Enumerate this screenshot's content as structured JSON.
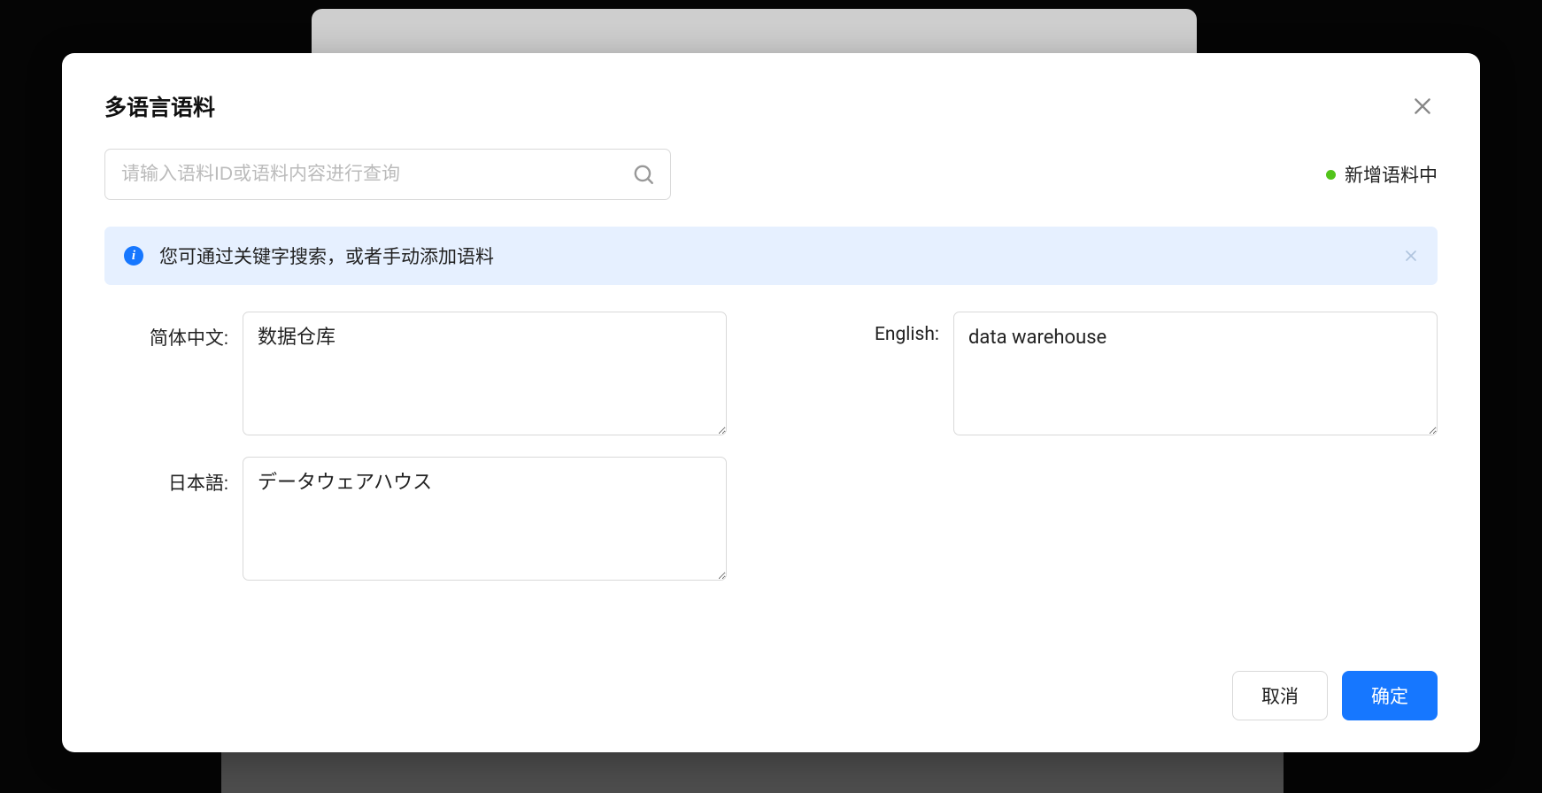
{
  "modal": {
    "title": "多语言语料",
    "search": {
      "placeholder": "请输入语料ID或语料内容进行查询"
    },
    "status": {
      "text": "新增语料中"
    },
    "alert": {
      "text": "您可通过关键字搜索，或者手动添加语料"
    },
    "fields": {
      "zh_cn": {
        "label": "简体中文:",
        "value": "数据仓库"
      },
      "en": {
        "label": "English:",
        "value": "data warehouse"
      },
      "ja": {
        "label": "日本語:",
        "value": "データウェアハウス"
      }
    },
    "footer": {
      "cancel": "取消",
      "confirm": "确定"
    }
  }
}
